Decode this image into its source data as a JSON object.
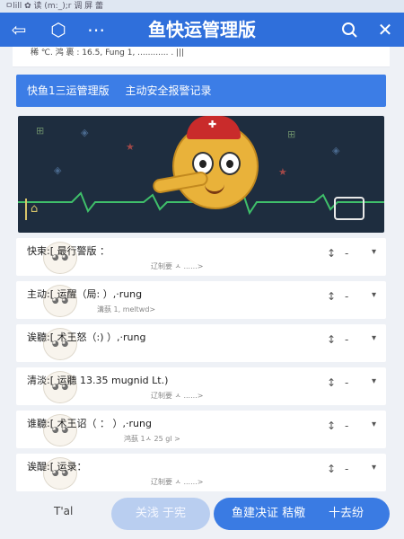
{
  "status_bar": {
    "text": "ㅁlill ✿ 读 (m:_);r 调 屏 蕾"
  },
  "header": {
    "title": "鱼快运管理版",
    "back_icon": "back-arrow-icon",
    "cube_icon": "cube-icon",
    "more_icon": "more-dots-icon",
    "settings_icon": "chat-settings-icon",
    "close_icon": "close-icon"
  },
  "peek": {
    "text": "稀 ℃. 鸿 裹 : 16.5, Fung                      1, ............ . |||"
  },
  "banner": {
    "left": "快鱼1三运管理版",
    "right": "主动安全报警记录"
  },
  "video": {
    "left_icon": "home-icon",
    "right_icon": "fullscreen-icon",
    "mascot": "fish-mascot-icon"
  },
  "rows": [
    {
      "main": "快束:[ 最行警版 ：",
      "sub": "",
      "sort": "↕",
      "dash": "-",
      "chev": "▾",
      "sub_right": "辽制要 ㅅ ......>"
    },
    {
      "main": "主动:[ 运醒（局: ）,·rung",
      "sub": "溝蓺    1, meltwd>",
      "sort": "↕",
      "dash": "-",
      "chev": "▾"
    },
    {
      "main": "诶聽:[ 术王怒（:) ）,·rung",
      "sub": "",
      "sort": "↕",
      "dash": "-",
      "chev": "▾"
    },
    {
      "main": "清淡:[ 运聽 13.35 mugnid Lt.)",
      "sub": "辽制要 ㅅ ......>",
      "sort": "↕",
      "dash": "-",
      "chev": "▾"
    },
    {
      "main": "谁聽:[ 术王诏（ ： ）,·rung",
      "sub": "鸿蓺    1ㅅ 25 gl >",
      "sort": "↕",
      "dash": "-",
      "chev": "▾"
    },
    {
      "main": "诶醍:[ 运录：",
      "sub": "辽制要 ㅅ ......>",
      "sort": "↕",
      "dash": "-",
      "chev": "▾"
    }
  ],
  "footer": {
    "left_label": "T'al",
    "secondary_button": "关浅 于宪",
    "primary_left": "鱼建决证 秸儆",
    "primary_right": "十去纷"
  },
  "colors": {
    "brand": "#2f6fdb",
    "banner": "#3c7de6",
    "video_bg": "#1e2d3f"
  }
}
